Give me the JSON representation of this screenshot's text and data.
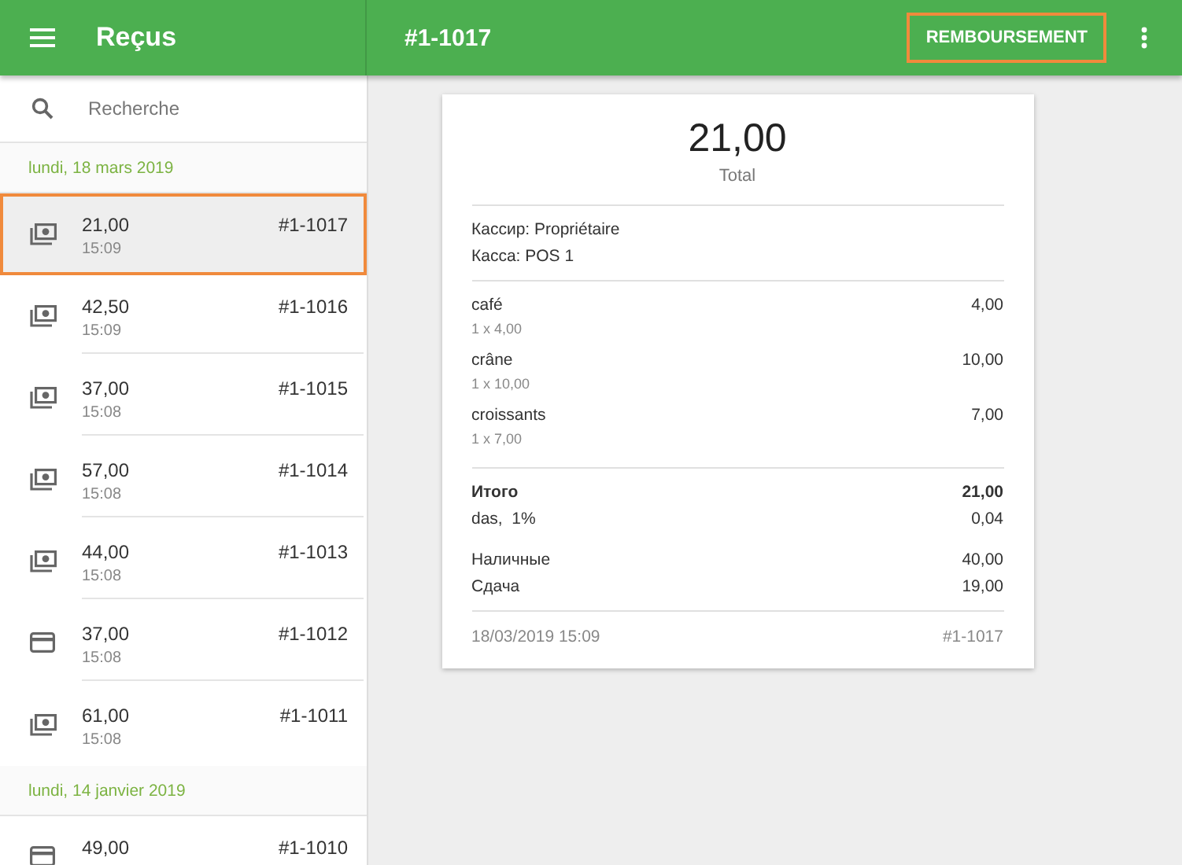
{
  "app_bar": {
    "title": "Reçus",
    "receipt_number": "#1-1017",
    "refund_button": {
      "label": "REMBOURSEMENT",
      "highlighted": true
    }
  },
  "search": {
    "placeholder": "Recherche"
  },
  "receipt_groups": [
    {
      "date": "lundi, 18 mars 2019",
      "receipts": [
        {
          "kind": "cash",
          "amount": "21,00",
          "time": "15:09",
          "number": "#1-1017",
          "selected": true
        },
        {
          "kind": "cash",
          "amount": "42,50",
          "time": "15:09",
          "number": "#1-1016",
          "selected": false
        },
        {
          "kind": "cash",
          "amount": "37,00",
          "time": "15:08",
          "number": "#1-1015",
          "selected": false
        },
        {
          "kind": "cash",
          "amount": "57,00",
          "time": "15:08",
          "number": "#1-1014",
          "selected": false
        },
        {
          "kind": "cash",
          "amount": "44,00",
          "time": "15:08",
          "number": "#1-1013",
          "selected": false
        },
        {
          "kind": "card",
          "amount": "37,00",
          "time": "15:08",
          "number": "#1-1012",
          "selected": false
        },
        {
          "kind": "cash",
          "amount": "61,00",
          "time": "15:08",
          "number": "#1-1011",
          "selected": false
        }
      ]
    },
    {
      "date": "lundi, 14 janvier 2019",
      "receipts": [
        {
          "kind": "card",
          "amount": "49,00",
          "number": "#1-1010",
          "selected": false
        }
      ]
    }
  ],
  "receipt": {
    "total": "21,00",
    "total_label": "Total",
    "info": [
      "Кассир: Propriétaire",
      "Касса: POS 1"
    ],
    "items": [
      {
        "name": "café",
        "detail": "1 x 4,00",
        "price": "4,00"
      },
      {
        "name": "crâne",
        "detail": "1 x 10,00",
        "price": "10,00"
      },
      {
        "name": "croissants",
        "detail": "1 x 7,00",
        "price": "7,00"
      }
    ],
    "totals": [
      {
        "label": "Итого",
        "value": "21,00",
        "bold": true
      },
      {
        "label": "das,  1%",
        "value": "0,04",
        "bold": false
      }
    ],
    "payments": [
      {
        "label": "Наличные",
        "value": "40,00"
      },
      {
        "label": "Сдача",
        "value": "19,00"
      }
    ],
    "footer_date": "18/03/2019 15:09",
    "footer_number": "#1-1017"
  }
}
